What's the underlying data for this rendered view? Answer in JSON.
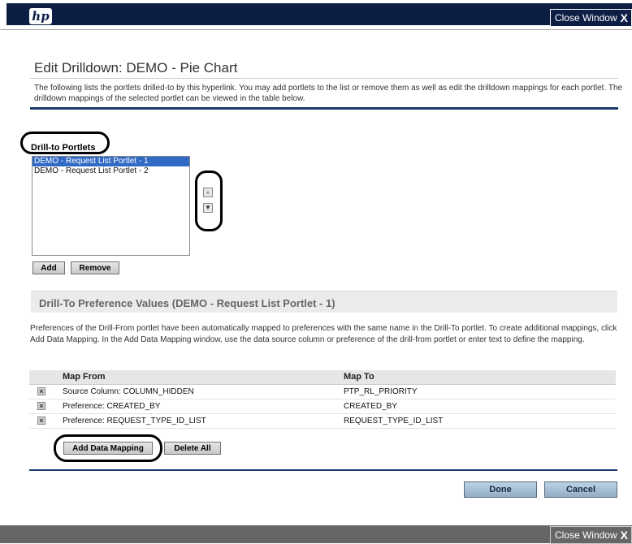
{
  "window": {
    "logo_text": "hp",
    "close_label": "Close Window",
    "close_glyph": "X"
  },
  "page": {
    "title": "Edit Drilldown: DEMO - Pie Chart",
    "description": "The following lists the portlets drilled-to by this hyperlink. You may add portlets to the list or remove them as well as edit the drilldown mappings for each portlet. The drilldown mappings of the selected portlet can be viewed in the table below."
  },
  "drill_to": {
    "label": "Drill-to Portlets",
    "items": [
      {
        "label": "DEMO - Request List Portlet - 1",
        "selected": true
      },
      {
        "label": "DEMO - Request List Portlet - 2",
        "selected": false
      }
    ],
    "move_up_icon": "▲",
    "move_down_icon": "▼",
    "add_label": "Add",
    "remove_label": "Remove"
  },
  "preferences": {
    "header": "Drill-To Preference Values (DEMO - Request List Portlet - 1)",
    "description": "Preferences of the Drill-From portlet have been automatically mapped to preferences with the same name in the Drill-To portlet. To create additional mappings, click Add Data Mapping. In the Add Data Mapping window, use the data source column or preference of the drill-from portlet or enter text to define the mapping.",
    "columns": {
      "map_from": "Map From",
      "map_to": "Map To"
    },
    "rows": [
      {
        "from": "Source Column: COLUMN_HIDDEN",
        "to": "PTP_RL_PRIORITY"
      },
      {
        "from": "Preference: CREATED_BY",
        "to": "CREATED_BY"
      },
      {
        "from": "Preference: REQUEST_TYPE_ID_LIST",
        "to": "REQUEST_TYPE_ID_LIST"
      }
    ],
    "delete_glyph": "×",
    "add_mapping_label": "Add Data Mapping",
    "delete_all_label": "Delete All"
  },
  "footer": {
    "done_label": "Done",
    "cancel_label": "Cancel"
  }
}
